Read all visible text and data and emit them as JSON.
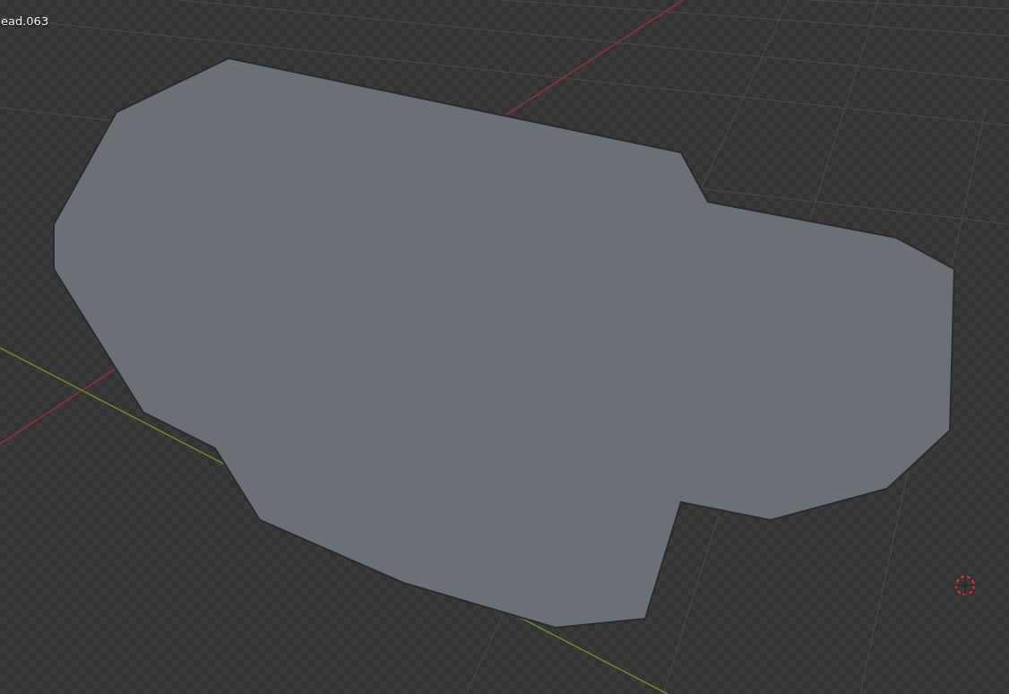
{
  "viewport": {
    "object_label": "ead.063"
  }
}
